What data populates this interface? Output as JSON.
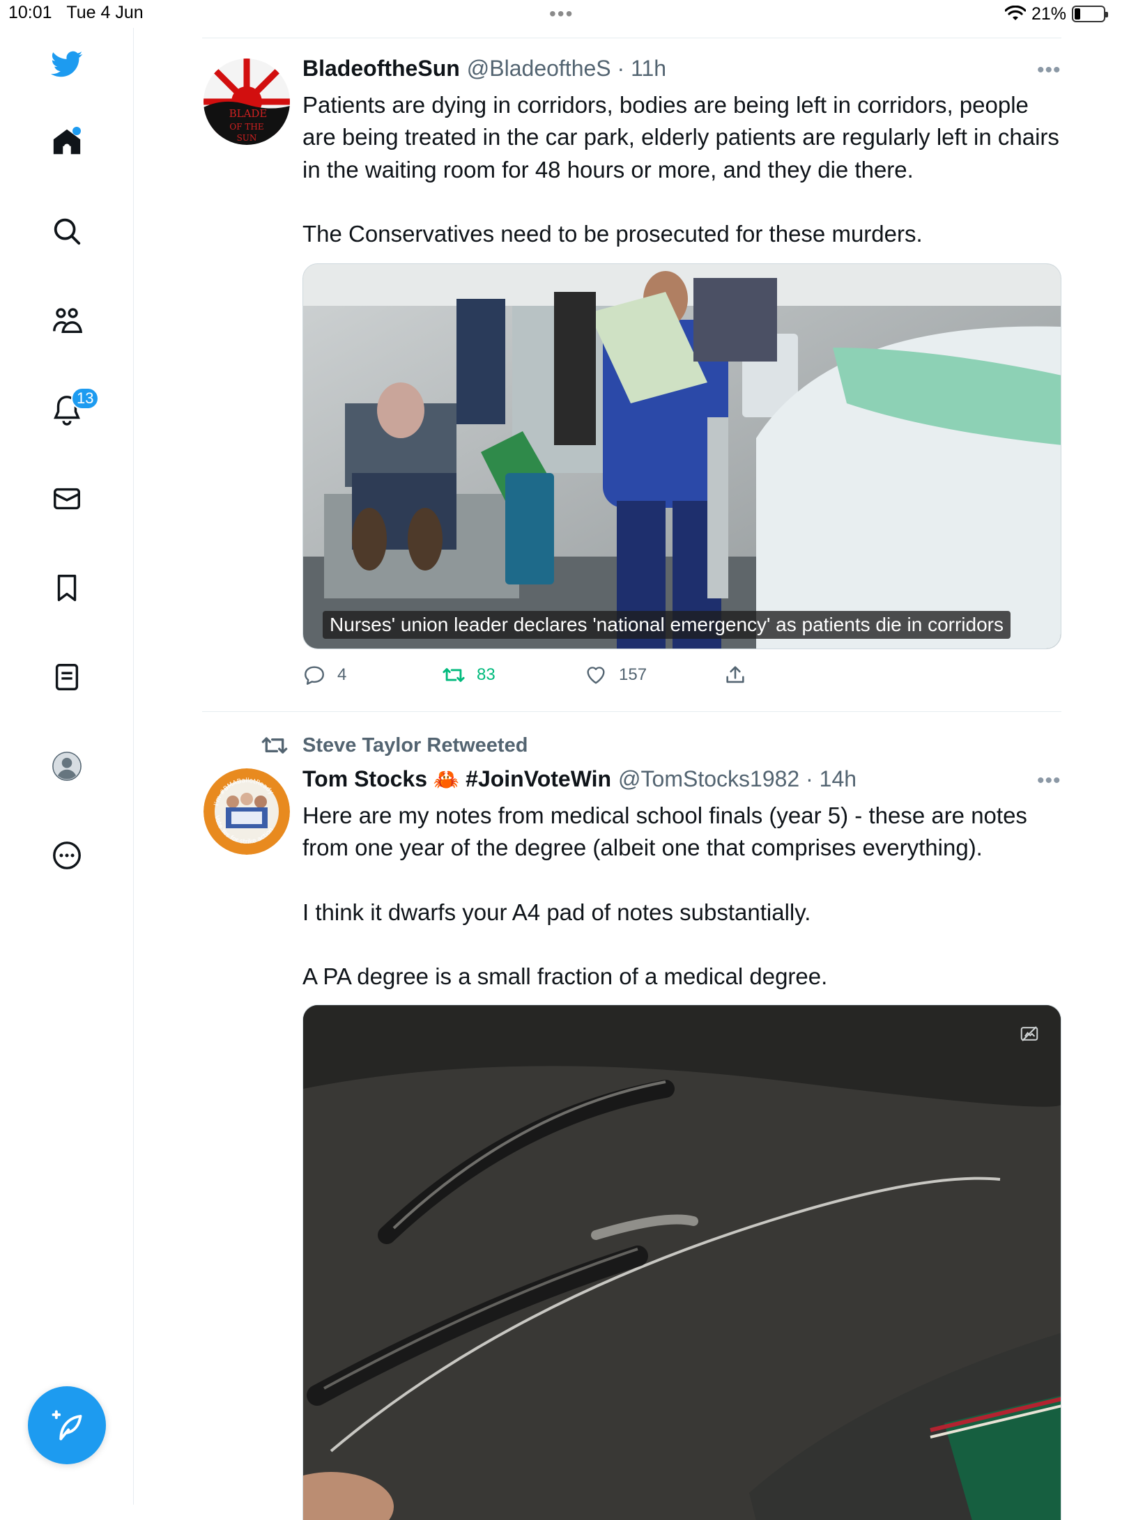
{
  "status_bar": {
    "time": "10:01",
    "date": "Tue 4 Jun",
    "battery": "21%",
    "battery_level": 0.21,
    "multitask_dots": "•••"
  },
  "sidebar": {
    "items": [
      {
        "name": "twitter-logo",
        "icon": "twitter-bird-icon"
      },
      {
        "name": "home",
        "icon": "home-icon",
        "has_dot": true
      },
      {
        "name": "explore",
        "icon": "search-icon"
      },
      {
        "name": "communities",
        "icon": "communities-icon"
      },
      {
        "name": "notifications",
        "icon": "bell-icon",
        "badge": "13"
      },
      {
        "name": "messages",
        "icon": "mail-icon"
      },
      {
        "name": "bookmarks",
        "icon": "bookmark-icon"
      },
      {
        "name": "lists",
        "icon": "lists-icon"
      },
      {
        "name": "profile",
        "icon": "profile-icon"
      },
      {
        "name": "more",
        "icon": "more-circle-icon"
      }
    ],
    "compose_icon": "compose-tweet-icon",
    "accent_color": "#1d9bf0"
  },
  "tweets": [
    {
      "display_name": "BladeoftheSun",
      "handle_meta": "@BladeoftheS · 11h",
      "more": "•••",
      "avatar_text": [
        "BLADE",
        "OF THE",
        "SUN"
      ],
      "text": [
        "Patients are dying in corridors, bodies are being left in corridors, people are being treated in the car park, elderly patients are regularly left in chairs in the waiting room for 48 hours or more, and they die there.",
        "The Conservatives need to be prosecuted for these murders."
      ],
      "media_caption": "Nurses' union leader declares 'national emergency' as patients die in corridors",
      "actions": {
        "replies": "4",
        "retweets": "83",
        "likes": "157"
      }
    },
    {
      "retweeted_by": "Steve Taylor Retweeted",
      "display_name": "Tom Stocks",
      "display_tag": "#JoinVoteWin",
      "emoji": "🦀",
      "handle_meta": "@TomStocks1982 · 14h",
      "more": "•••",
      "avatar_ring_text": [
        "I'm #BMABallotReady",
        "Vote Yes for strike action"
      ],
      "text": [
        "Here are my notes from medical school finals (year 5) - these are notes from one year of the degree (albeit one that comprises everything).",
        "I think it dwarfs your A4 pad of notes substantially.",
        "A PA degree is a small fraction of a medical degree."
      ]
    }
  ]
}
